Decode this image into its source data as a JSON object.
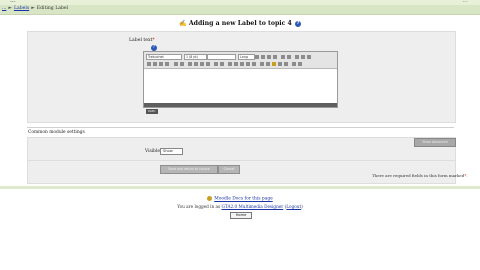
{
  "page": {
    "site_title": "...",
    "top_right": "...",
    "breadcrumb": [
      {
        "label": "..."
      },
      {
        "label": "Labels"
      },
      {
        "label": "Editing Label"
      }
    ],
    "heading": "Adding a new Label to topic 4",
    "help_glyph": "?"
  },
  "form": {
    "label_field": "Label text",
    "required_marker": "*",
    "toolbar": {
      "font_select": "Trebuchet",
      "size_select": "1 (8 pt)",
      "lang_select": "Lang"
    },
    "path_text": "Path:"
  },
  "common_settings": {
    "title": "Common module settings",
    "show_advanced": "Show Advanced",
    "visible_label": "Visible",
    "visible_value": "Show"
  },
  "buttons": {
    "save": "Save and return to course",
    "cancel": "Cancel"
  },
  "required_note": "There are required fields in this form marked",
  "footer": {
    "docs_link": "Moodle Docs for this page",
    "logged_in_prefix": "You are logged in as",
    "logged_in_user": "GTA2.0 Multimedia Designer",
    "logout": "Logout",
    "home": "Home"
  },
  "colors": {
    "nav_bg": "#d9e6c6",
    "panel_bg": "#eeeeee",
    "link": "#1a33a8",
    "required": "#cc0000"
  }
}
